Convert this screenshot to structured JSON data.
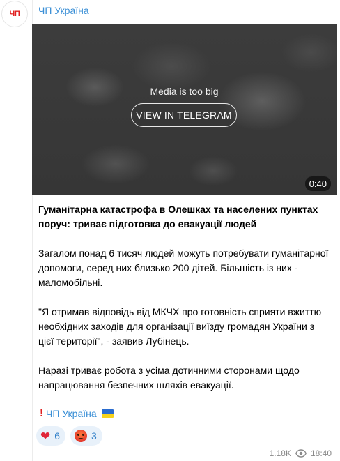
{
  "channel": {
    "avatar_text": "ЧП",
    "name": "ЧП Україна"
  },
  "media": {
    "message": "Media is too big",
    "button_label": "VIEW IN TELEGRAM",
    "duration": "0:40"
  },
  "post": {
    "title": "Гуманітарна катастрофа в Олешках та населених пунктах поруч: триває підготовка до евакуації людей",
    "paragraphs": [
      "Загалом понад 6 тисяч людей можуть потребувати гуманітарної допомоги, серед них близько 200 дітей. Більшість із них - маломобільні.",
      "\"Я отримав відповідь від МКЧХ про готовність сприяти вжиттю необхідних заходів для організації виїзду громадян України з цієї території\", - заявив Лубінець.",
      "Наразі триває робота з усіма дотичними сторонами щодо напрацювання безпечних шляхів евакуації."
    ],
    "signature": "ЧП Україна"
  },
  "reactions": [
    {
      "icon": "heart-icon",
      "count": "6"
    },
    {
      "icon": "angry-face-icon",
      "count": "3"
    }
  ],
  "meta": {
    "views": "1.18K",
    "time": "18:40"
  },
  "colors": {
    "accent": "#3a8fd6",
    "brand_red": "#e02020",
    "reaction_bg": "#e8f1fa"
  }
}
